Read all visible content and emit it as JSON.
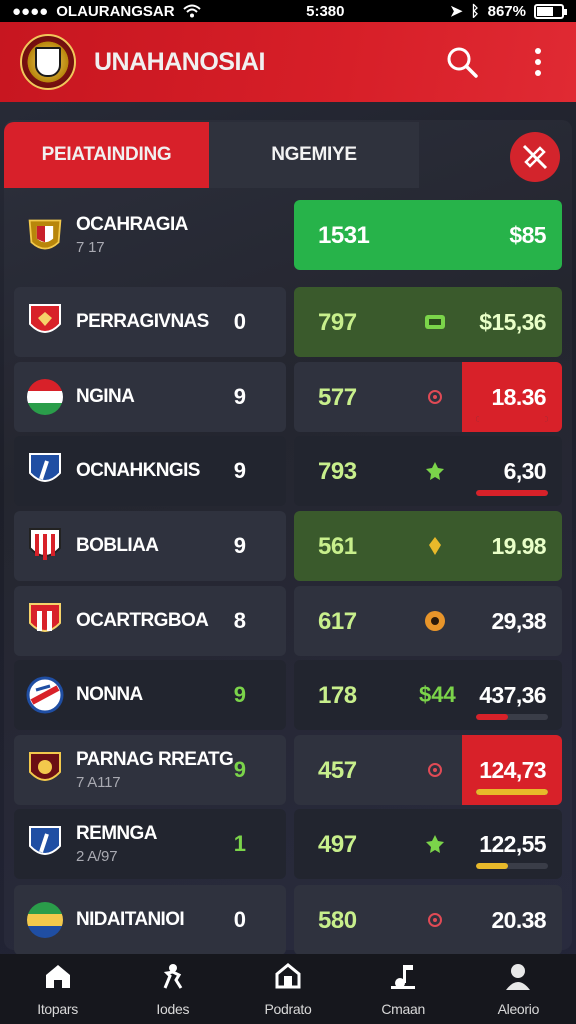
{
  "status_bar": {
    "carrier": "OLAURANGSAR",
    "time": "5:380",
    "battery": "867%"
  },
  "header": {
    "title": "UNAHANOSIAI"
  },
  "tabs": [
    {
      "label": "PEIATAINDING"
    },
    {
      "label": "NGEMIYE"
    }
  ],
  "rows": [
    {
      "name": "OCAHRAGIA",
      "sub": "7 17",
      "rank": "",
      "count": "1531",
      "value": "$85",
      "style": "bright",
      "crest": "royal",
      "bar": null
    },
    {
      "name": "PERRAGIVNAS",
      "sub": "",
      "rank": "0",
      "count": "797",
      "value": "$15,36",
      "style": "green",
      "crest": "red-shield",
      "bar": null
    },
    {
      "name": "NGINA",
      "sub": "",
      "rank": "9",
      "count": "577",
      "value": "18.36",
      "style": "plain",
      "crest": "tricolor",
      "bar": {
        "pct": 100,
        "color": "#d82129"
      },
      "value_red": true
    },
    {
      "name": "OCNAHKNGIS",
      "sub": "",
      "rank": "9",
      "count": "793",
      "value": "6,30",
      "style": "dark",
      "crest": "blue-shield",
      "bar": {
        "pct": 100,
        "color": "#d82129"
      }
    },
    {
      "name": "BOBLIAA",
      "sub": "",
      "rank": "9",
      "count": "561",
      "value": "19.98",
      "style": "green",
      "crest": "striped",
      "bar": null
    },
    {
      "name": "OCARTRGBOA",
      "sub": "",
      "rank": "8",
      "count": "617",
      "value": "29,38",
      "style": "plain",
      "crest": "striped-red",
      "bar": null
    },
    {
      "name": "NONNA",
      "sub": "",
      "rank": "9",
      "count": "178",
      "value": "437,36",
      "style": "dark",
      "crest": "blue-circle",
      "marker": "$44",
      "bar": {
        "pct": 45,
        "color": "#d82129"
      },
      "rank_green": true
    },
    {
      "name": "PARNAG RREATG",
      "sub": "7 A117",
      "rank": "9",
      "count": "457",
      "value": "124,73",
      "style": "plain",
      "crest": "dark-red",
      "bar": {
        "pct": 100,
        "color": "#e8b92a"
      },
      "value_red": true,
      "rank_green": true
    },
    {
      "name": "REMNGA",
      "sub": "2 A/97",
      "rank": "1",
      "count": "497",
      "value": "122,55",
      "style": "dark",
      "crest": "blue-shield",
      "bar": {
        "pct": 45,
        "color": "#e8b92a"
      },
      "rank_green": true
    },
    {
      "name": "NIDAITANIOI",
      "sub": "",
      "rank": "0",
      "count": "580",
      "value": "20.38",
      "style": "plain",
      "crest": "ring",
      "bar": null
    }
  ],
  "bottom_nav": [
    {
      "label": "Itopars",
      "icon": "home-icon"
    },
    {
      "label": "Iodes",
      "icon": "player-icon"
    },
    {
      "label": "Podrato",
      "icon": "stadium-icon"
    },
    {
      "label": "Cmaan",
      "icon": "music-icon"
    },
    {
      "label": "Aleorio",
      "icon": "profile-icon"
    }
  ]
}
